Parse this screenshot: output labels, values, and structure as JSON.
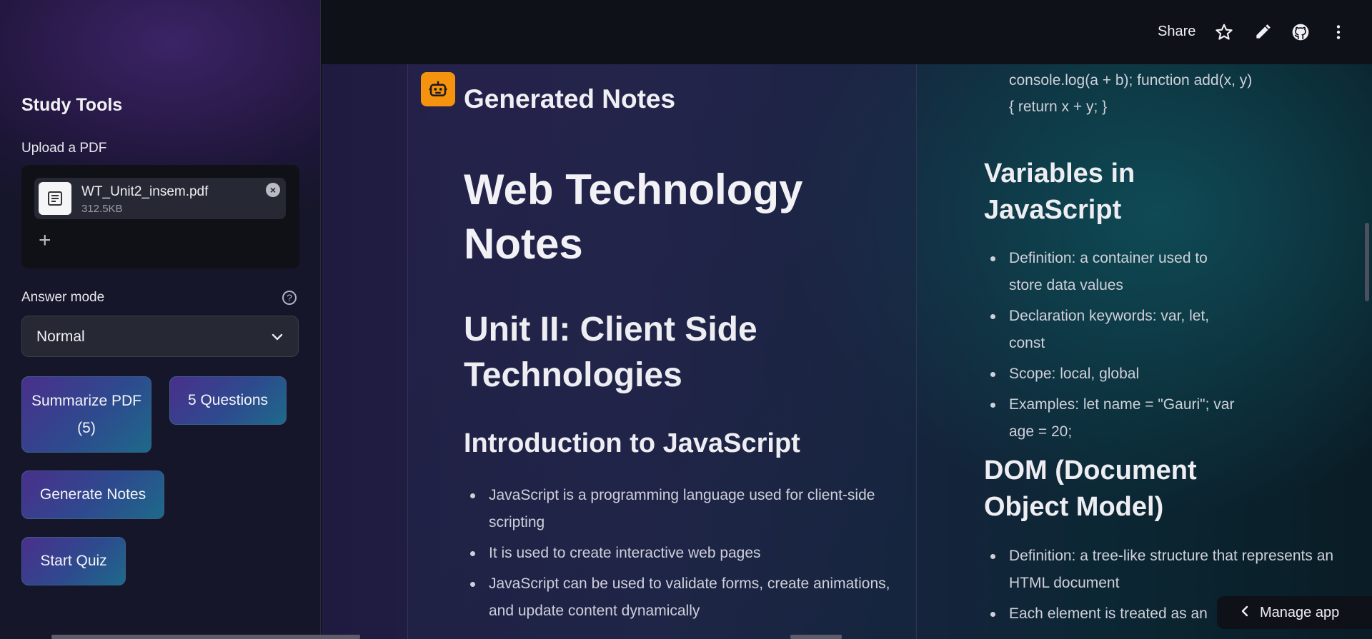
{
  "sidebar": {
    "title": "Study Tools",
    "upload_label": "Upload a PDF",
    "file": {
      "name": "WT_Unit2_insem.pdf",
      "size": "312.5KB",
      "icon": "document-icon"
    },
    "answer_mode_label": "Answer mode",
    "answer_mode_value": "Normal",
    "buttons": {
      "summarize": "Summarize PDF (5)",
      "questions": "5 Questions",
      "generate_notes": "Generate Notes",
      "start_quiz": "Start Quiz"
    }
  },
  "header": {
    "share": "Share",
    "icons": [
      "star-icon",
      "pencil-icon",
      "github-icon",
      "more-vertical-icon"
    ]
  },
  "notes_card": {
    "title": "Generated Notes",
    "avatar_icon": "robot-icon",
    "h1": "Web Technology Notes",
    "h2": "Unit II: Client Side Technologies",
    "h3": "Introduction to JavaScript",
    "bullets": [
      "JavaScript is a programming language used for client-side scripting",
      "It is used to create interactive web pages",
      "JavaScript can be used to validate forms, create animations, and update content dynamically"
    ]
  },
  "right_column": {
    "code_lines": [
      "console.log(a + b); function add(x, y)",
      "{ return x + y; }"
    ],
    "variables": {
      "heading": "Variables in JavaScript",
      "bullets": [
        "Definition: a container used to store data values",
        "Declaration keywords: var, let, const",
        "Scope: local, global",
        "Examples: let name = \"Gauri\"; var age = 20;"
      ]
    },
    "dom": {
      "heading": "DOM (Document Object Model)",
      "bullets": [
        "Definition: a tree-like structure that represents an HTML document",
        "Each element is treated as an"
      ]
    }
  },
  "manage_app": "Manage app",
  "colors": {
    "accent": "#f5920e",
    "button_gradient_start": "#4a2f8c",
    "button_gradient_end": "#1d6a8a"
  }
}
